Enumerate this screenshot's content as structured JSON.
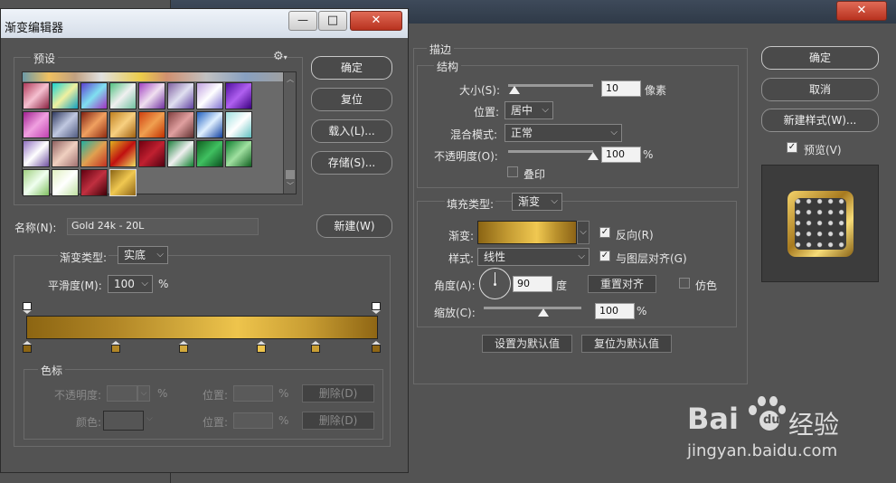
{
  "layer_style": {
    "stroke_title": "描边",
    "structure": "结构",
    "size_label": "大小(S):",
    "size_value": "10",
    "size_unit": "像素",
    "position_label": "位置:",
    "position_value": "居中",
    "blend_label": "混合模式:",
    "blend_value": "正常",
    "opacity_label": "不透明度(O):",
    "opacity_value": "100",
    "opacity_unit": "%",
    "overprint_label": "叠印",
    "fill_type_label": "填充类型:",
    "fill_type_value": "渐变",
    "gradient_label": "渐变:",
    "reverse_label": "反向(R)",
    "style_label": "样式:",
    "style_value": "线性",
    "align_label": "与图层对齐(G)",
    "angle_label": "角度(A):",
    "angle_value": "90",
    "angle_unit": "度",
    "reset_align_btn": "重置对齐",
    "dither_label": "仿色",
    "scale_label": "缩放(C):",
    "scale_value": "100",
    "scale_unit": "%",
    "make_default_btn": "设置为默认值",
    "reset_default_btn": "复位为默认值",
    "ok_btn": "确定",
    "cancel_btn": "取消",
    "new_style_btn": "新建样式(W)...",
    "preview_label": "预览(V)",
    "close_icon": "✕"
  },
  "gradient_editor": {
    "title": "渐变编辑器",
    "presets_label": "预设",
    "gear_icon": "gear-icon",
    "ok_btn": "确定",
    "reset_btn": "复位",
    "load_btn": "载入(L)...",
    "save_btn": "存储(S)...",
    "name_label": "名称(N):",
    "name_value": "Gold 24k - 20L",
    "new_btn": "新建(W)",
    "gradient_type_label": "渐变类型:",
    "gradient_type_value": "实底",
    "smoothness_label": "平滑度(M):",
    "smoothness_value": "100",
    "smoothness_unit": "%",
    "stops_group": "色标",
    "opacity_label": "不透明度:",
    "opacity_unit": "%",
    "location_label_1": "位置:",
    "location_unit_1": "%",
    "delete_btn_1": "删除(D)",
    "color_label": "颜色:",
    "location_label_2": "位置:",
    "location_unit_2": "%",
    "delete_btn_2": "删除(D)",
    "minimize_icon": "—",
    "maximize_icon": "□",
    "close_icon": "✕"
  },
  "watermark": {
    "brand": "Bai",
    "brand2": "经验",
    "url": "jingyan.baidu.com"
  }
}
